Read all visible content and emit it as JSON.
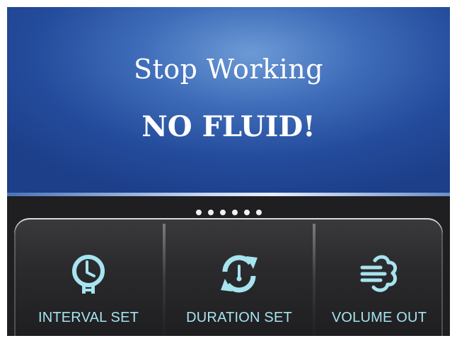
{
  "screen": {
    "status_line1": "Stop Working",
    "status_line2": "NO FLUID!"
  },
  "pager": {
    "total_pages": 6
  },
  "buttons": [
    {
      "label": "INTERVAL SET",
      "icon": "clock-icon"
    },
    {
      "label": "DURATION SET",
      "icon": "refresh-timer-icon"
    },
    {
      "label": "VOLUME OUT",
      "icon": "wind-icon"
    }
  ],
  "colors": {
    "accent": "#a6e4ef",
    "screen_bg": "#2f5aaa",
    "panel_bg": "#2b2b2e"
  }
}
